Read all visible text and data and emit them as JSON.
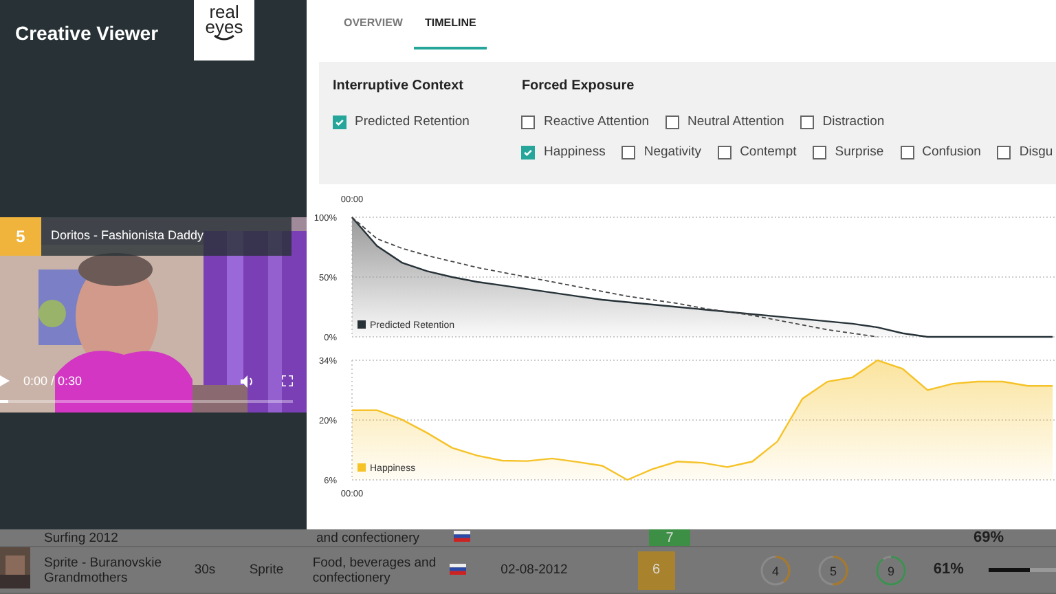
{
  "app": {
    "title": "Creative Viewer",
    "logo": [
      "real",
      "eyes"
    ]
  },
  "video": {
    "rank": "5",
    "title": "Doritos - Fashionista Daddy",
    "time": "0:00 / 0:30",
    "level": 0.03
  },
  "tabs": [
    {
      "label": "OVERVIEW",
      "selected": false
    },
    {
      "label": "TIMELINE",
      "selected": true
    }
  ],
  "filters": [
    {
      "heading": "Interruptive Context",
      "options": [
        {
          "label": "Predicted Retention",
          "checked": true
        }
      ]
    },
    {
      "heading": "Forced Exposure",
      "options": [
        {
          "label": "Reactive Attention",
          "checked": false
        },
        {
          "label": "Neutral Attention",
          "checked": false,
          "new_line": false
        },
        {
          "label": "Distraction",
          "checked": false,
          "new_line": false
        },
        {
          "label": "Happiness",
          "checked": true,
          "new_line": true
        },
        {
          "label": "Negativity",
          "checked": false,
          "new_line": false
        },
        {
          "label": "Contempt",
          "checked": false,
          "new_line": false
        },
        {
          "label": "Surprise",
          "checked": false,
          "new_line": false
        },
        {
          "label": "Confusion",
          "checked": false,
          "new_line": false
        },
        {
          "label": "Disgu",
          "checked": false,
          "new_line": false
        }
      ]
    }
  ],
  "charts": [
    {
      "time_label": "00:00",
      "chart_data": {
        "type": "area",
        "ylim": [
          0,
          100
        ],
        "yticks": [
          {
            "value": 0,
            "label": "0%"
          },
          {
            "value": 50,
            "label": "50%"
          },
          {
            "value": 100,
            "label": "100%"
          }
        ],
        "series": [
          {
            "name": "Predicted Retention",
            "color": "#263238",
            "values": [
              100,
              76,
              62,
              55,
              50,
              46,
              43,
              40,
              37,
              34,
              31,
              29,
              27,
              25,
              23,
              21,
              19,
              17,
              15,
              13,
              11,
              8,
              3,
              0,
              0,
              0,
              0,
              0,
              0
            ]
          },
          {
            "type": "line",
            "line_style": "dashed",
            "color": "#444444",
            "values": [
              100,
              82,
              74,
              68,
              63,
              58,
              54,
              50,
              46,
              42,
              38,
              34,
              31,
              28,
              24,
              21,
              18,
              14,
              10,
              6,
              3,
              0,
              null,
              null,
              null,
              null,
              null,
              null,
              null
            ]
          }
        ]
      }
    },
    {
      "time_label": "00:00",
      "chart_data": {
        "type": "area",
        "ylim": [
          6,
          34
        ],
        "yticks": [
          {
            "value": 6,
            "label": "6%"
          },
          {
            "value": 20,
            "label": "20%"
          },
          {
            "value": 34,
            "label": "34%"
          }
        ],
        "series": [
          {
            "name": "Happiness",
            "color": "#f5c227",
            "values": [
              22.3,
              22.3,
              20.1,
              17,
              13.5,
              11.7,
              10.5,
              10.4,
              11,
              10.2,
              9.3,
              6,
              8.5,
              10.3,
              10,
              9,
              10.3,
              15,
              25,
              29,
              30,
              34,
              32,
              27,
              28.5,
              29,
              29,
              28,
              28
            ]
          }
        ]
      }
    }
  ],
  "table": {
    "rows": [
      {
        "title": "Surfing 2012",
        "category": "and confectionery",
        "score": "7",
        "color": "#3d8f45",
        "percent": "69%"
      },
      {
        "title": "Sprite - Buranovskie Grandmothers",
        "length": "30s",
        "brand": "Sprite",
        "category": "Food, beverages and confectionery",
        "date": "02-08-2012",
        "score": "6",
        "color": "#a8822c",
        "metrics": [
          {
            "value": "4",
            "level": 0.4,
            "color": "#a8782a"
          },
          {
            "value": "5",
            "level": 0.5,
            "color": "#a8782a"
          },
          {
            "value": "9",
            "level": 0.9,
            "color": "#3d8f50"
          }
        ],
        "percent": "61%",
        "level": 0.61
      }
    ]
  }
}
